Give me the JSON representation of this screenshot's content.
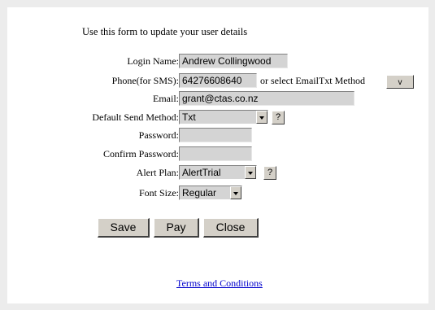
{
  "intro": "Use this form to update your user details",
  "fields": {
    "login_label": "Login Name:",
    "login_value": "Andrew Collingwood",
    "phone_label": "Phone(for SMS):",
    "phone_value": "64276608640",
    "phone_alt_text": "or select EmailTxt Method",
    "phone_alt_button": "v",
    "email_label": "Email:",
    "email_value": "grant@ctas.co.nz",
    "send_method_label": "Default Send Method:",
    "send_method_value": "Txt",
    "send_method_help": "?",
    "password_label": "Password:",
    "password_value": "",
    "confirm_label": "Confirm Password:",
    "confirm_value": "",
    "alert_plan_label": "Alert Plan:",
    "alert_plan_value": "AlertTrial",
    "alert_plan_help": "?",
    "font_size_label": "Font Size:",
    "font_size_value": "Regular"
  },
  "buttons": {
    "save": "Save",
    "pay": "Pay",
    "close": "Close"
  },
  "footer": {
    "terms_link": "Terms and Conditions"
  }
}
